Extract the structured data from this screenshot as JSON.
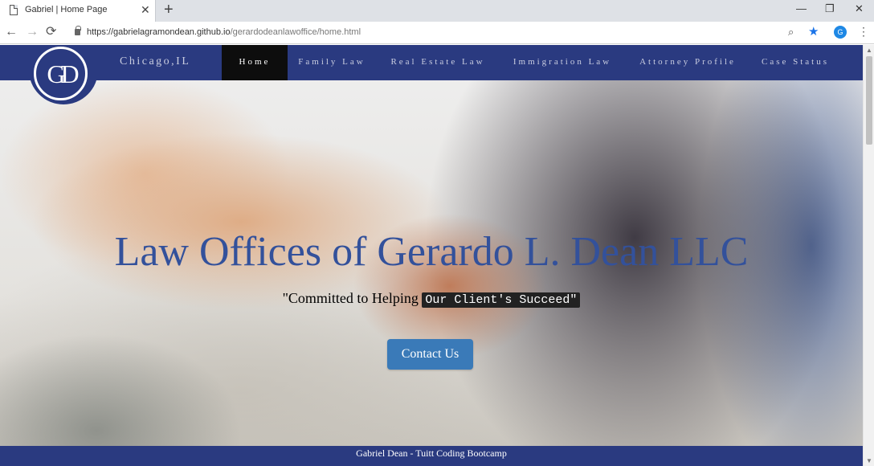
{
  "browser": {
    "tab_title": "Gabriel | Home Page",
    "tab_close": "✕",
    "new_tab": "+",
    "window_controls": {
      "minimize": "—",
      "maximize": "❐",
      "close": "✕"
    },
    "nav": {
      "back": "←",
      "forward": "→",
      "reload": "⟳"
    },
    "url_host": "https://gabrielagramondean.github.io",
    "url_path": "/gerardodeanlawoffice/home.html",
    "zoom_glyph": "⌕",
    "star_glyph": "★",
    "profile_initial": "G",
    "menu_glyph": "⋮",
    "icons": [
      "page-icon",
      "close-icon",
      "plus-icon",
      "back-icon",
      "forward-icon",
      "reload-icon",
      "lock-icon",
      "zoom-icon",
      "star-icon",
      "menu-icon"
    ]
  },
  "site": {
    "logo_text": "GD",
    "location": "Chicago,IL",
    "nav_items": [
      {
        "label": "Home",
        "active": true
      },
      {
        "label": "Family Law",
        "active": false
      },
      {
        "label": "Real Estate Law",
        "active": false
      },
      {
        "label": "Immigration Law",
        "active": false
      },
      {
        "label": "Attorney Profile",
        "active": false
      },
      {
        "label": "Case Status",
        "active": false
      }
    ],
    "hero": {
      "title": "Law Offices of Gerardo L. Dean LLC",
      "tagline_prefix": "\"Committed to Helping ",
      "tagline_code": "Our Client's Succeed\"",
      "button": "Contact Us"
    },
    "footer": "Gabriel Dean - Tuitt Coding Bootcamp",
    "colors": {
      "brand_navy": "#2a3a80",
      "title_blue": "#33519b",
      "button_blue": "#3a7ab8",
      "active_nav": "#0d0d0d"
    }
  }
}
